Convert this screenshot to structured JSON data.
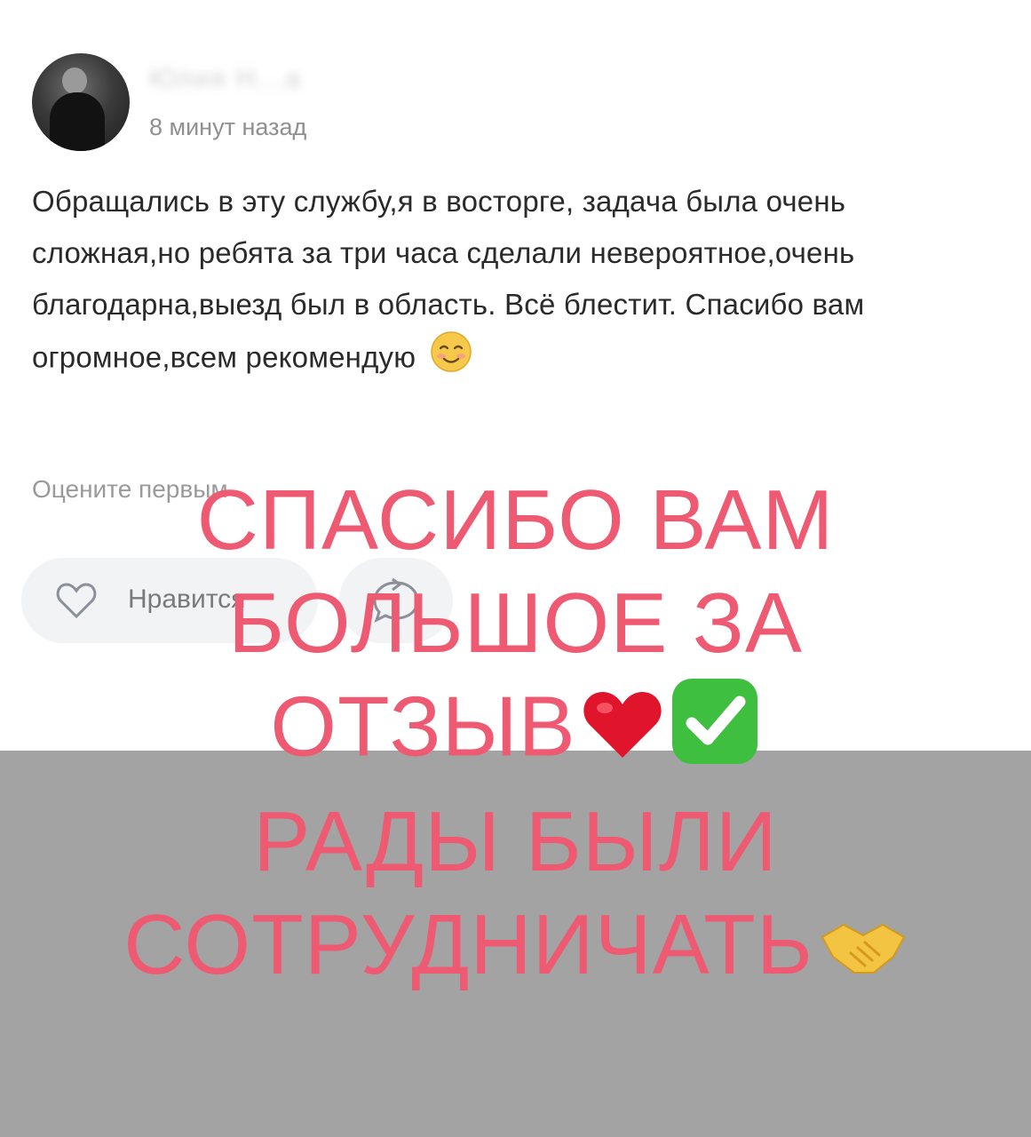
{
  "post": {
    "author_name": "Юлия Н…а",
    "timestamp": "8 минут назад",
    "text": "Обращались в эту службу,я в восторге, задача была очень сложная,но ребята за три часа сделали невероятное,очень благодарна,выезд был в область. Всё блестит. Спасибо вам огромное,всем рекомендую",
    "rate_prompt": "Оцените первым",
    "like_label": "Нравится",
    "icons": [
      "smiling-face-icon",
      "heart-outline-icon",
      "reply-icon"
    ]
  },
  "overlay": {
    "lines": [
      "СПАСИБО ВАМ",
      "БОЛЬШОЕ ЗА",
      "ОТЗЫВ",
      "РАДЫ БЫЛИ",
      "СОТРУДНИЧАТЬ"
    ],
    "color": "#ee5a72",
    "emoji_icons": [
      "red-heart-icon",
      "check-mark-button-icon",
      "handshake-icon"
    ]
  },
  "colors": {
    "background": "#ffffff",
    "bottom_band": "#a3a3a3",
    "overlay_text": "#ee5a72",
    "button_bg": "#f2f3f5"
  }
}
